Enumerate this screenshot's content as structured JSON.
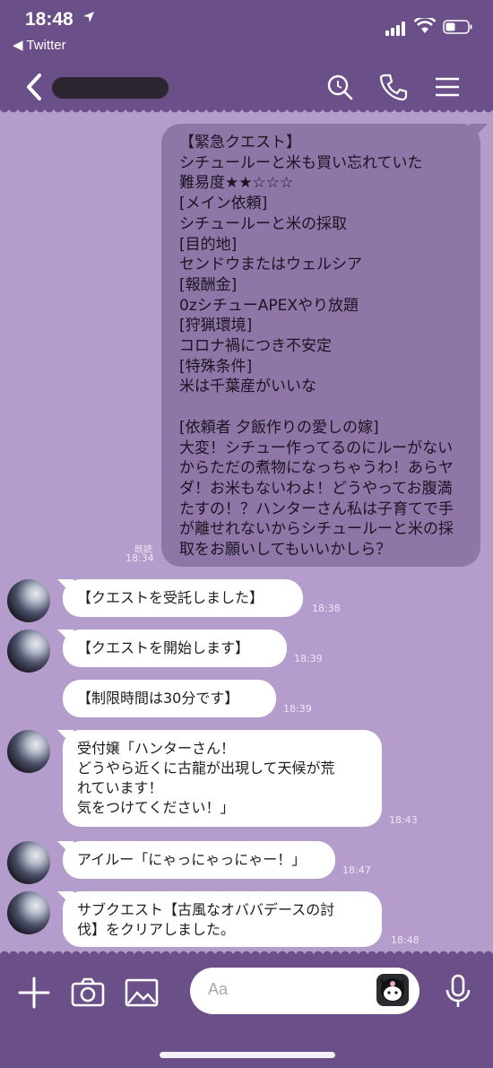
{
  "status_bar": {
    "time": "18:48",
    "back_app": "◀ Twitter"
  },
  "header": {
    "contact_name": ""
  },
  "messages": {
    "outgoing": {
      "text": "【緊急クエスト】\nシチュールーと米も買い忘れていた\n難易度★★☆☆☆\n[メイン依頼]\nシチュールーと米の採取\n[目的地]\nセンドウまたはウェルシア\n[報酬金]\n0zシチューAPEXやり放題\n[狩猟環境]\nコロナ禍につき不安定\n[特殊条件]\n米は千葉産がいいな\n\n[依頼者 夕飯作りの愛しの嫁]\n大変！シチュー作ってるのにルーがない\nからただの煮物になっちゃうわ！あらヤ\nダ！お米もないわよ！どうやってお腹満\nたすの！？ハンターさん私は子育てで手\nが離せれないからシチュールーと米の採\n取をお願いしてもいいかしら？",
      "read": "既読",
      "time": "18:34"
    },
    "incoming": [
      {
        "text": "【クエストを受託しました】",
        "time": "18:38"
      },
      {
        "text": "【クエストを開始します】",
        "time": "18:39"
      },
      {
        "text": "【制限時間は30分です】",
        "time": "18:39"
      },
      {
        "text": "受付嬢「ハンターさん！\nどうやら近くに古龍が出現して天候が荒\nれています！\n気をつけてください！」",
        "time": "18:43"
      },
      {
        "text": "アイルー「にゃっにゃっにゃー！」",
        "time": "18:47"
      },
      {
        "text": "サブクエスト【古風なオババデースの討\n伐】をクリアしました。",
        "time": "18:48"
      }
    ]
  },
  "input_bar": {
    "placeholder": "Aa"
  },
  "colors": {
    "header": "#6b4f88",
    "background": "#b49ccc",
    "outgoing_bubble": "#8e76a6",
    "incoming_bubble": "#ffffff"
  }
}
